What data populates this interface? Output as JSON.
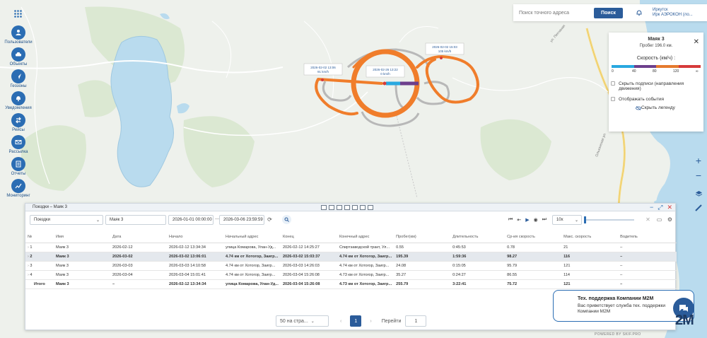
{
  "sidebar": {
    "items": [
      {
        "label": "Пользователи",
        "icon": "user-icon"
      },
      {
        "label": "Объекты",
        "icon": "car-icon"
      },
      {
        "label": "Геозоны",
        "icon": "geofence-icon"
      },
      {
        "label": "Уведомления",
        "icon": "bell-icon"
      },
      {
        "label": "Рейсы",
        "icon": "trip-icon"
      },
      {
        "label": "Рассылка",
        "icon": "mail-icon"
      },
      {
        "label": "Отчеты",
        "icon": "report-icon"
      },
      {
        "label": "Мониторинг",
        "icon": "monitoring-icon"
      }
    ]
  },
  "topbar": {
    "search_placeholder": "Поиск точного адреса",
    "search_button": "Поиск",
    "city": "Иркутск",
    "company": "Ирк АЭРОКОН (ло..."
  },
  "map": {
    "labels": [
      {
        "text": "2026-02-02 13:06",
        "speed": "91 km/h"
      },
      {
        "text": "2026-02-26 13:22",
        "speed": "0 km/h"
      },
      {
        "text": "2026-02-02 15:03",
        "speed": "105 km/h"
      }
    ]
  },
  "legend": {
    "title": "Маяк 3",
    "mileage": "Пробег 196.0 км.",
    "speed_label": "Скорость (км/ч) :",
    "ticks": [
      "0",
      "40",
      "80",
      "120",
      "∞"
    ],
    "segment_colors": [
      "#29a8e0",
      "#6d3f8c",
      "#e57a2e",
      "#d63a3a"
    ],
    "hide_labels": "Скрыть подписи (направления движения)",
    "show_events": "Отображать события",
    "hide_legend": "Скрыть легенду"
  },
  "trips": {
    "title": "Поездки – Маяк 3",
    "type_select": "Поездки",
    "object_select": "Маяк 3",
    "date_from": "2026-01-01 00:00:00",
    "date_to": "2026-03-06 23:59:59",
    "playback_speed": "10x",
    "columns": [
      "№",
      "Имя",
      "Дата",
      "Начало",
      "Начальный адрес",
      "Конец",
      "Конечный адрес",
      "Пробег(км)",
      "Длительность",
      "Ср-ия скорость",
      "Макс. скорость",
      "Водитель"
    ],
    "rows": [
      [
        "1",
        "Маяк 3",
        "2026-02-12",
        "2026-02-12 13:34:34",
        "улица Комарова, Улан-Уд...",
        "2026-02-12 14:25:27",
        "Спиртзаводской тракт, Ул...",
        "0.55",
        "0:45:53",
        "0.78",
        "21",
        "–"
      ],
      [
        "2",
        "Маяк 3",
        "2026-03-02",
        "2026-03-02 13:06:01",
        "4.74 км от Хотогор, Заигр...",
        "2026-03-02 15:03:37",
        "4.74 км от Хотогор, Заигр...",
        "195.39",
        "1:59:36",
        "98.27",
        "116",
        "–"
      ],
      [
        "3",
        "Маяк 3",
        "2026-03-03",
        "2026-03-03 14:10:58",
        "4.74 км от Хотогор, Заигр...",
        "2026-03-03 14:26:03",
        "4.74 км от Хотогор, Заигр...",
        "24.08",
        "0:15:05",
        "95.79",
        "121",
        "–"
      ],
      [
        "4",
        "Маяк 3",
        "2026-03-04",
        "2026-03-04 15:01:41",
        "4.74 км от Хотогор, Заигр...",
        "2026-03-04 15:26:08",
        "4.73 км от Хотогор, Заигр...",
        "35.27",
        "0:24:27",
        "86.55",
        "114",
        "–"
      ]
    ],
    "total": [
      "Итого",
      "Маяк 3",
      "–",
      "2026-02-12 13:34:34",
      "улица Комарова, Улан-Уд...",
      "2026-03-04 15:26:08",
      "4.73 км от Хотогор, Заигр...",
      "255.79",
      "3:22:41",
      "75.72",
      "121",
      "–"
    ]
  },
  "pagination": {
    "page_size": "50 на стра...",
    "current": "1",
    "goto_label": "Перейти",
    "goto_value": "1"
  },
  "support": {
    "title": "Тех. поддержка Компании M2M",
    "message": "Вас приветствует служба тех. поддержки Компании M2M"
  },
  "brand": "2M",
  "powered": "POWERED BY SKIF.PRO"
}
